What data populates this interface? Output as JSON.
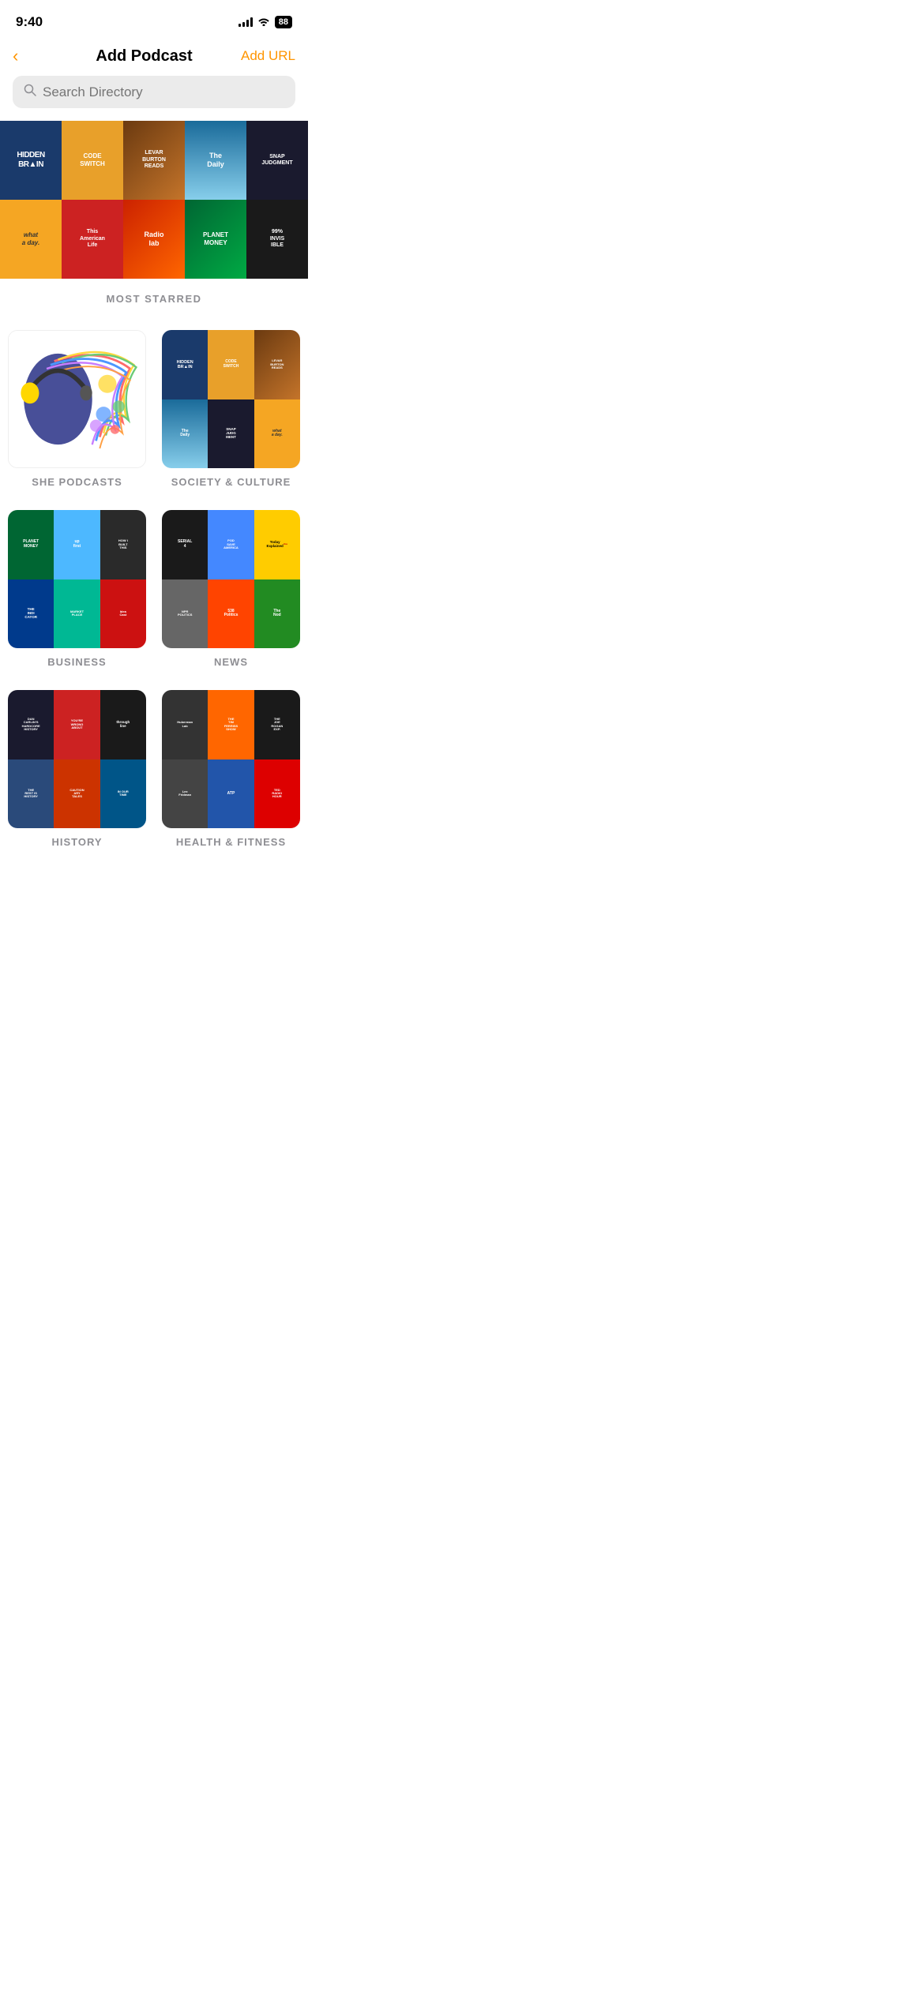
{
  "statusBar": {
    "time": "9:40",
    "battery": "88",
    "signal": [
      3,
      5,
      7,
      10,
      12
    ],
    "wifi": true
  },
  "header": {
    "back_label": "‹",
    "title": "Add Podcast",
    "action_label": "Add URL"
  },
  "search": {
    "placeholder": "Search Directory"
  },
  "mostStarred": {
    "label": "MOST STARRED",
    "podcasts": [
      {
        "name": "HIDDEN BRAIN",
        "color": "c-hidden-brain"
      },
      {
        "name": "CODE SWITCH",
        "color": "c-code-switch"
      },
      {
        "name": "LEVAR BURTON READS",
        "color": "c-levar"
      },
      {
        "name": "The Daily",
        "color": "c-daily"
      },
      {
        "name": "SNAP JUDGMENT",
        "color": "c-snap-judgment"
      },
      {
        "name": "what a day",
        "color": "c-whataday"
      },
      {
        "name": "This American Life",
        "color": "c-american-life"
      },
      {
        "name": "Radiolab",
        "color": "c-radiolab"
      },
      {
        "name": "PLANET MONEY",
        "color": "c-planet-money"
      },
      {
        "name": "99% INVISIBLE",
        "color": "c-99invisible"
      }
    ]
  },
  "categories": [
    {
      "id": "she-podcasts",
      "label": "SHE PODCASTS",
      "type": "single",
      "color": "#fff"
    },
    {
      "id": "society-culture",
      "label": "SOCIETY & CULTURE",
      "type": "grid",
      "cells": [
        {
          "name": "HIDDEN BRAIN",
          "color": "c-hidden-brain"
        },
        {
          "name": "CODE SWITCH",
          "color": "c-code-switch"
        },
        {
          "name": "LEVAR BURTON READS",
          "color": "c-levar"
        },
        {
          "name": "The Daily",
          "color": "c-daily"
        },
        {
          "name": "SNAP JUDGMENT",
          "color": "c-snap-judgment"
        },
        {
          "name": "what a day",
          "color": "c-whataday"
        }
      ]
    },
    {
      "id": "business",
      "label": "BUSINESS",
      "type": "grid",
      "cells": [
        {
          "name": "PLANET MONEY",
          "color": "c-planet-money"
        },
        {
          "name": "Up First",
          "color": "c-business-2"
        },
        {
          "name": "How I Built This",
          "color": "c-business-3"
        },
        {
          "name": "The Indicator",
          "color": "c-business-4"
        },
        {
          "name": "Marketplace",
          "color": "c-business-5"
        },
        {
          "name": "HBR IdeaCast",
          "color": "c-business-6"
        }
      ]
    },
    {
      "id": "news",
      "label": "NEWS",
      "type": "grid",
      "cells": [
        {
          "name": "SERIAL 4",
          "color": "c-serial"
        },
        {
          "name": "POD SAVE AMERICA",
          "color": "c-pod-save"
        },
        {
          "name": "Explained",
          "color": "c-explained"
        },
        {
          "name": "NPR POLITICS",
          "color": "c-npr-politics"
        },
        {
          "name": "538 Politics",
          "color": "c-538"
        },
        {
          "name": "The Nod",
          "color": "c-nod"
        }
      ]
    },
    {
      "id": "history",
      "label": "HISTORY",
      "type": "grid",
      "cells": [
        {
          "name": "Hardcore History",
          "color": "c-snap-judgment"
        },
        {
          "name": "You're Wrong About",
          "color": "c-american-life"
        },
        {
          "name": "Throughline",
          "color": "c-99invisible"
        },
        {
          "name": "The Rest is History",
          "color": "c-hidden-brain"
        },
        {
          "name": "Cautionary Tales",
          "color": "c-radiolab"
        },
        {
          "name": "In Our Time",
          "color": "c-planet-money"
        }
      ]
    },
    {
      "id": "health",
      "label": "HEALTH & FITNESS",
      "type": "grid",
      "cells": [
        {
          "name": "Huberman Lab",
          "color": "c-daily"
        },
        {
          "name": "Tim Ferriss Show",
          "color": "c-pod-save"
        },
        {
          "name": "Joe Rogan Experience",
          "color": "c-serial"
        },
        {
          "name": "Lex Fridman",
          "color": "c-business-4"
        },
        {
          "name": "ATP",
          "color": "c-business-5"
        },
        {
          "name": "TED Radio Hour",
          "color": "c-american-life"
        }
      ]
    }
  ]
}
